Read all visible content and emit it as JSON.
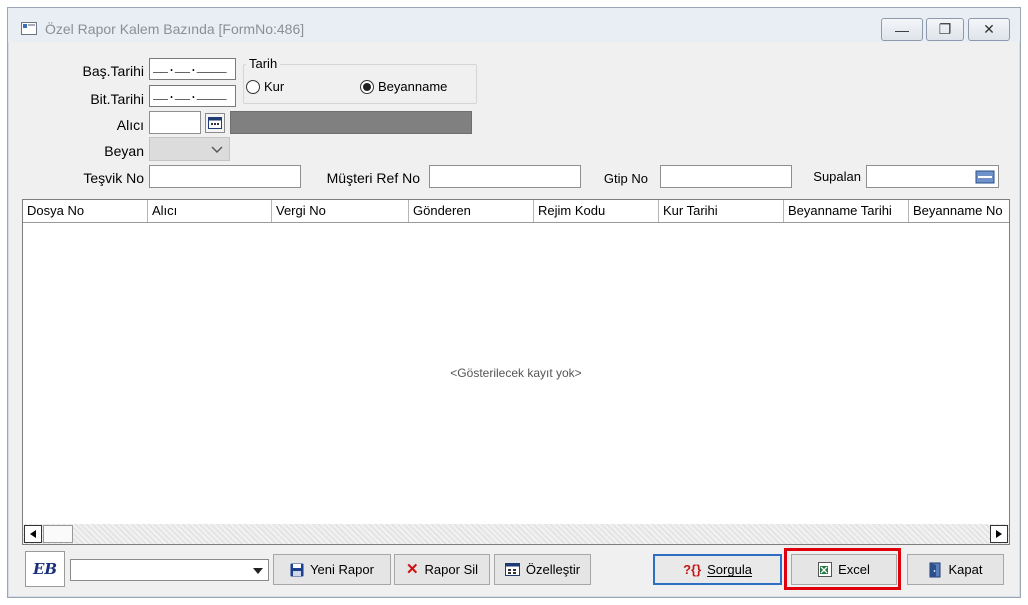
{
  "window": {
    "title": "Özel Rapor Kalem Bazında [FormNo:486]",
    "controls": {
      "minimize": "—",
      "maximize": "❐",
      "close": "✕"
    }
  },
  "form": {
    "bas_tarihi_label": "Baş.Tarihi",
    "bas_tarihi_value": "__.__.____",
    "bit_tarihi_label": "Bit.Tarihi",
    "bit_tarihi_value": "__.__.____",
    "tarih_group_title": "Tarih",
    "radio_kur": "Kur",
    "radio_beyanname": "Beyanname",
    "selected_radio": "Beyanname",
    "alici_label": "Alıcı",
    "beyan_label": "Beyan",
    "tesvik_label": "Teşvik No",
    "musteri_ref_label": "Müşteri Ref No",
    "gtip_label": "Gtip No",
    "supalan_label": "Supalan"
  },
  "grid": {
    "columns": [
      "Dosya No",
      "Alıcı",
      "Vergi No",
      "Gönderen",
      "Rejim Kodu",
      "Kur Tarihi",
      "Beyanname Tarihi",
      "Beyanname No"
    ],
    "empty_text": "<Gösterilecek kayıt yok>"
  },
  "toolbar": {
    "logo_text": "EB",
    "yeni_rapor": "Yeni Rapor",
    "rapor_sil": "Rapor Sil",
    "ozellestir": "Özelleştir",
    "sorgula": "Sorgula",
    "excel": "Excel",
    "kapat": "Kapat"
  },
  "colors": {
    "highlight": "#e0000b",
    "sorgula_border": "#2e6fc4",
    "disabled_bar": "#808080"
  }
}
